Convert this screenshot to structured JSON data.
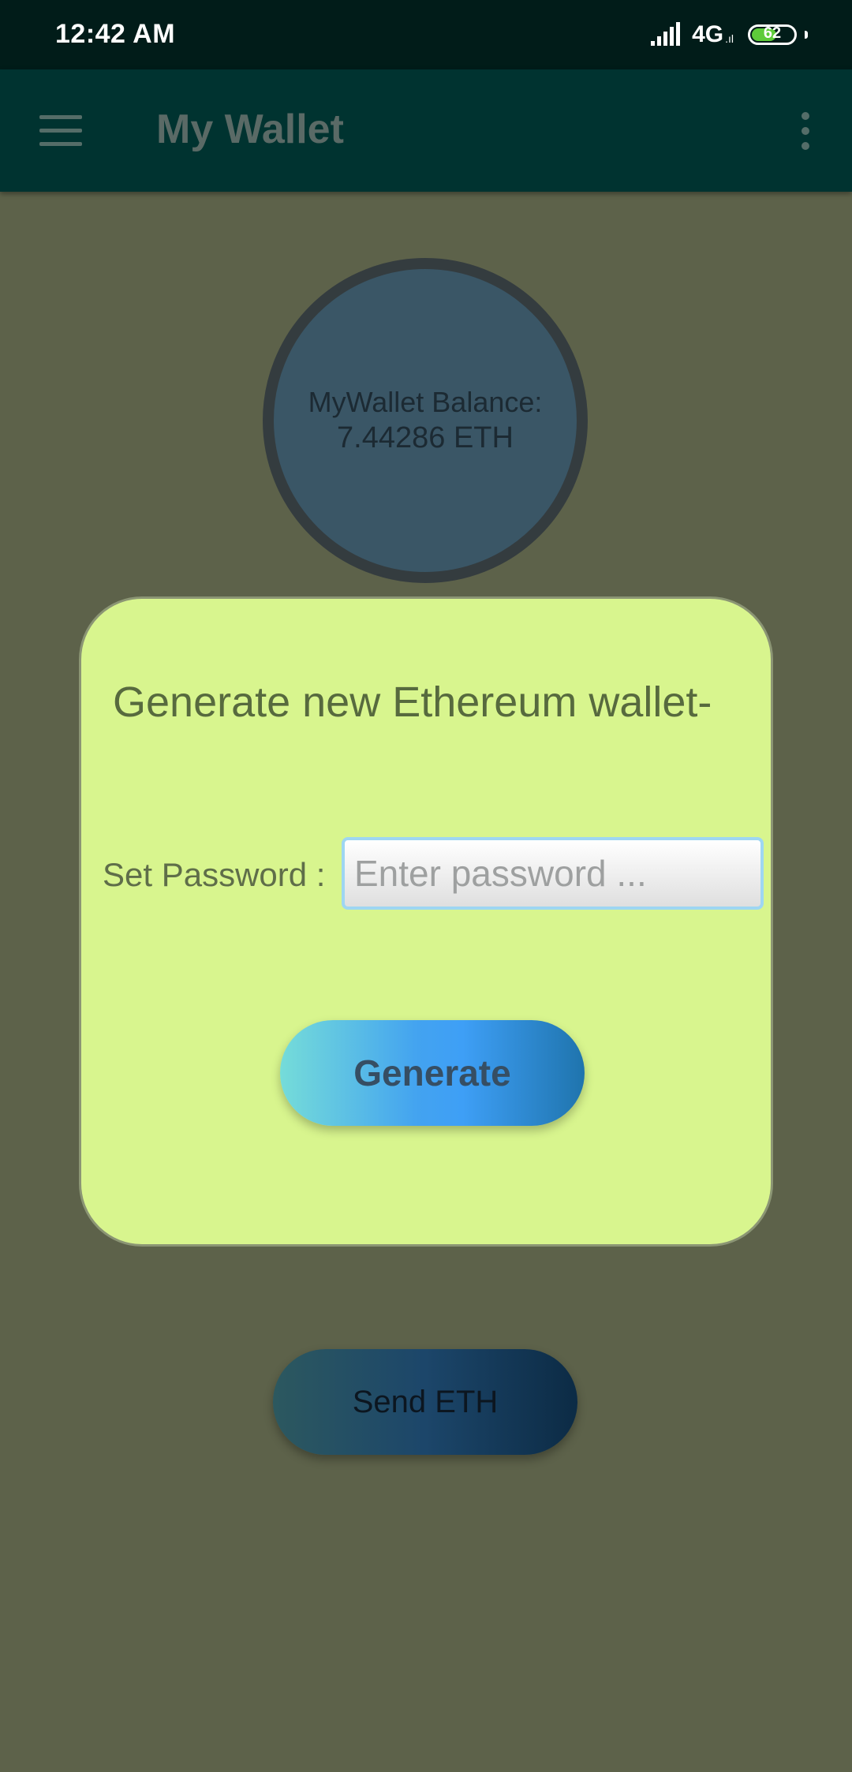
{
  "status_bar": {
    "time": "12:42 AM",
    "network": "4G",
    "network_sub": ".ıl",
    "battery_level": "62",
    "battery_fraction": 0.62,
    "icons": [
      "signal-icon",
      "battery-icon"
    ]
  },
  "app_bar": {
    "title": "My Wallet",
    "icons": [
      "menu-icon",
      "more-vert-icon"
    ]
  },
  "balance": {
    "label": "MyWallet Balance:",
    "value": "7.44286 ETH"
  },
  "dialog": {
    "title": "Generate new Ethereum wallet-",
    "password_label": "Set Password :",
    "password_placeholder": "Enter password ...",
    "password_value": "",
    "generate_label": "Generate"
  },
  "send_button_label": "Send ETH",
  "colors": {
    "background": "#5d624a",
    "status_bar": "#011c19",
    "app_bar": "#003330",
    "dialog_bg": "#d8f58e",
    "balance_circle": "#3a5666"
  }
}
